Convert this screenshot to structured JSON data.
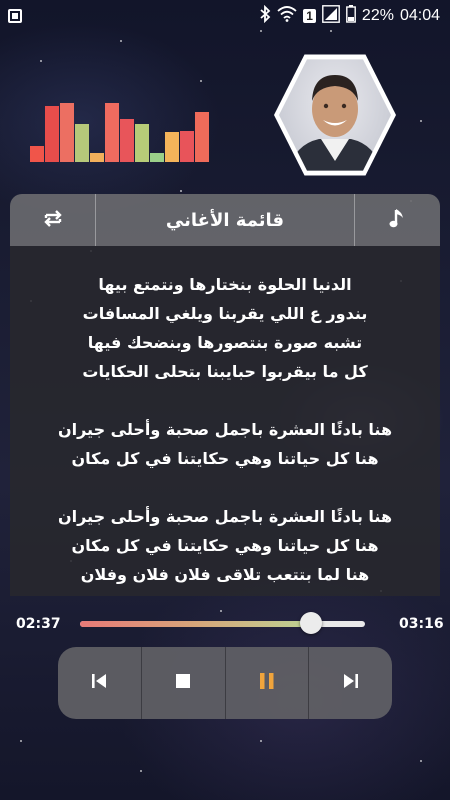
{
  "status_bar": {
    "notification_badge": "1",
    "battery": "22%",
    "time": "04:04",
    "icons": [
      "notification-icon",
      "bluetooth-icon",
      "wifi-icon",
      "sim-badge",
      "signal-icon",
      "battery-icon"
    ]
  },
  "equalizer": {
    "bar_levels": [
      0.25,
      0.9,
      0.95,
      0.62,
      0.15,
      0.95,
      0.7,
      0.62,
      0.15,
      0.48,
      0.5,
      0.8
    ],
    "bar_colors": [
      "#f0554a",
      "#e84d4b",
      "#ec6f62",
      "#b6c87a",
      "#f2b05b",
      "#ef6b5f",
      "#e8555a",
      "#b7cc78",
      "#9bd089",
      "#f4b45a",
      "#e8545a",
      "#ef6b5a"
    ]
  },
  "header": {
    "title": "قائمة الأغاني",
    "left_icon": "repeat-icon",
    "right_icon": "music-note-icon"
  },
  "lyrics": {
    "lines": [
      "الدنيا الحلوة بنختارها ونتمتع بيها",
      "بندور ع اللي يقربنا ويلغي المسافات",
      "تشبه صورة بنتصورها وبنضحك فيها",
      "كل ما بيقربوا حبايبنا بتحلى الحكايات",
      "",
      "هنا بادئًا العشرة باجمل صحبة وأحلى جيران",
      "هنا كل حياتنا وهي حكايتنا في كل مكان",
      "",
      "هنا بادئًا العشرة باجمل صحبة وأحلى جيران",
      "هنا كل حياتنا وهي حكايتنا في كل مكان",
      "هنا لما بتتعب تلاقى فلان فلان وفلان"
    ]
  },
  "player": {
    "current_time": "02:37",
    "total_time": "03:16",
    "progress": 0.81,
    "controls": [
      "previous-icon",
      "stop-icon",
      "pause-icon",
      "next-icon"
    ],
    "pause_color": "#f0a43c"
  }
}
